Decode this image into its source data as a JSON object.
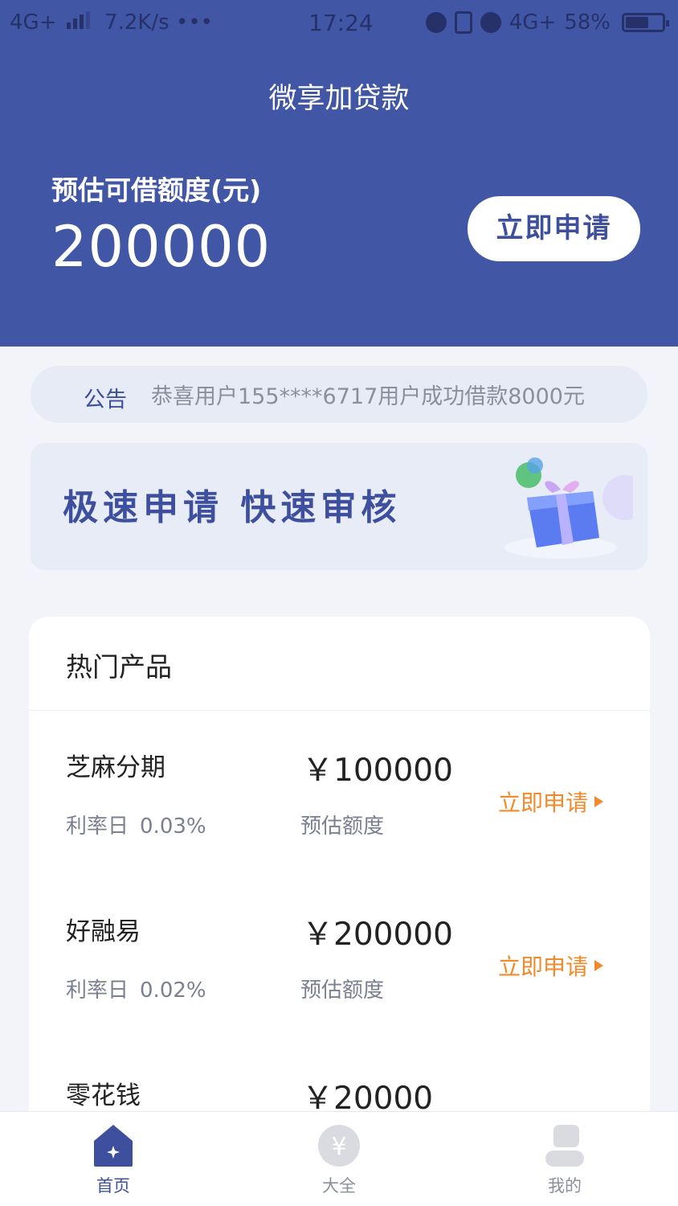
{
  "status_bar": {
    "network": "4G+",
    "speed": "7.2K/s •••",
    "time": "17:24",
    "network_right": "4G+",
    "battery": "58%"
  },
  "app": {
    "title": "微享加贷款"
  },
  "limit": {
    "label": "预估可借额度(元)",
    "amount": "200000",
    "apply_label": "立即申请"
  },
  "notice": {
    "label": "公告",
    "text": "恭喜用户155****6717用户成功借款8000元"
  },
  "banner": {
    "text": "极速申请 快速审核",
    "icon": "gift-box-icon"
  },
  "products": {
    "title": "热门产品",
    "items": [
      {
        "name": "芝麻分期",
        "rate_label": "利率日",
        "rate": "0.03%",
        "amount": "￥100000",
        "amount_label": "预估额度",
        "apply": "立即申请"
      },
      {
        "name": "好融易",
        "rate_label": "利率日",
        "rate": "0.02%",
        "amount": "￥200000",
        "amount_label": "预估额度",
        "apply": "立即申请"
      },
      {
        "name": "零花钱",
        "amount": "￥20000"
      }
    ]
  },
  "tabbar": {
    "tabs": [
      {
        "label": "首页",
        "icon": "home-icon",
        "active": true
      },
      {
        "label": "大全",
        "icon": "yuan-coin-icon",
        "active": false
      },
      {
        "label": "我的",
        "icon": "user-icon",
        "active": false
      }
    ]
  },
  "colors": {
    "header": "#4256a6",
    "accent": "#3d4f9d",
    "apply_orange": "#f28a2b",
    "background": "#f2f4f9"
  }
}
